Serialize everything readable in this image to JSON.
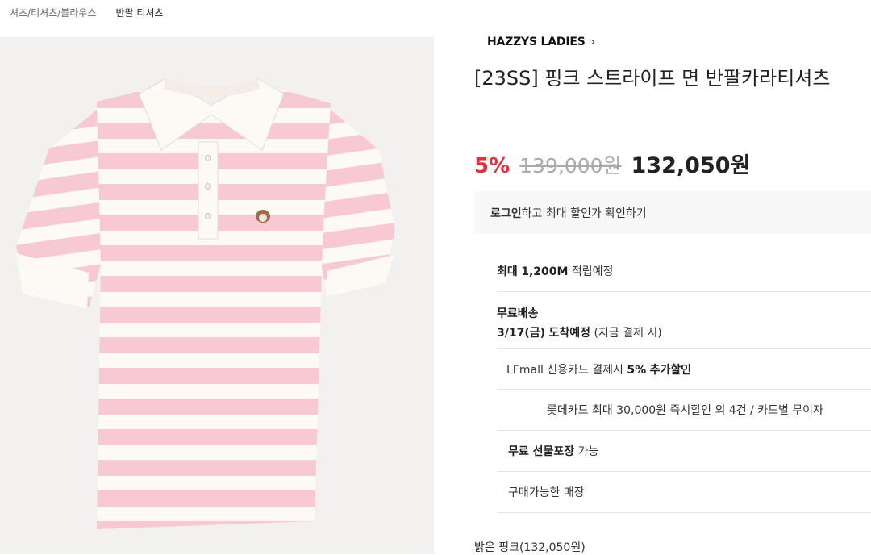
{
  "breadcrumb": {
    "category": "셔츠/티셔츠/블라우스",
    "current": "반팔 티셔츠"
  },
  "brand": {
    "name": "HAZZYS LADIES",
    "chevron": "›"
  },
  "product": {
    "title": "[23SS] 핑크 스트라이프 면 반팔카라티셔츠",
    "stripe_color": "#f7c9d3",
    "base_color": "#fdf9f5"
  },
  "price": {
    "discount": "5%",
    "original": "139,000원",
    "sale": "132,050원",
    "discount_color": "#e0353f"
  },
  "login_banner": {
    "login": "로그인",
    "rest": "하고 최대 할인가 확인하기"
  },
  "benefits": {
    "points": {
      "label": "최대",
      "amount": "1,200M",
      "suffix": "적립예정"
    },
    "shipping": {
      "title": "무료배송",
      "date": "3/17(금)",
      "arrival": "도착예정",
      "note": "(지금 결제 시)"
    },
    "card": {
      "prefix": "LFmall 신용카드 결제시",
      "rate": "5%",
      "suffix": "추가할인"
    },
    "lotte": {
      "text": "롯데카드 최대 30,000원 즉시할인 외 4건 / 카드별 무이자"
    },
    "gift": {
      "bold": "무료 선물포장",
      "rest": "가능"
    },
    "store": {
      "text": "구매가능한 매장"
    }
  },
  "option": {
    "label": "밝은 핑크(132,050원)"
  }
}
